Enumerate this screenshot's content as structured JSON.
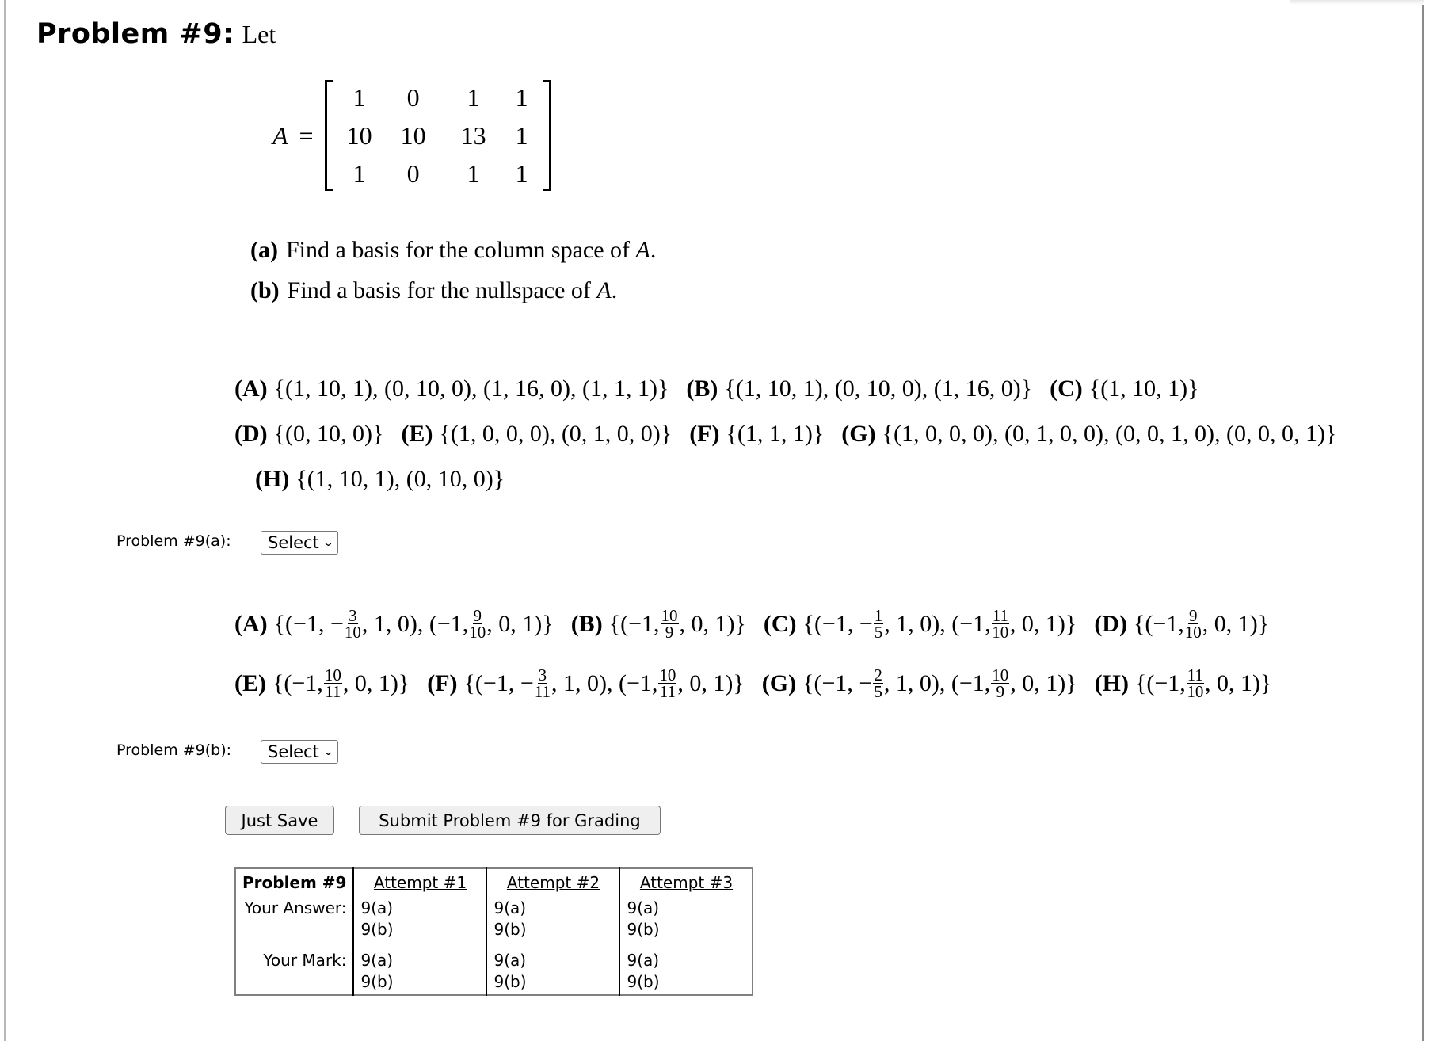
{
  "problem": {
    "title": "Problem #9:",
    "intro": "Let",
    "matrix_name": "A",
    "equals": "=",
    "matrix": [
      [
        "1",
        "0",
        "1",
        "1"
      ],
      [
        "10",
        "10",
        "13",
        "1"
      ],
      [
        "1",
        "0",
        "1",
        "1"
      ]
    ],
    "parts": [
      {
        "label": "(a)",
        "text": "Find a basis for the column space of ",
        "var": "A",
        "end": "."
      },
      {
        "label": "(b)",
        "text": "Find a basis for the nullspace of ",
        "var": "A",
        "end": "."
      }
    ]
  },
  "options_a": [
    {
      "label": "(A)",
      "text": "{(1, 10, 1), (0, 10, 0), (1, 16, 0), (1, 1, 1)}"
    },
    {
      "label": "(B)",
      "text": "{(1, 10, 1), (0, 10, 0), (1, 16, 0)}"
    },
    {
      "label": "(C)",
      "text": "{(1, 10, 1)}"
    },
    {
      "label": "(D)",
      "text": "{(0, 10, 0)}"
    },
    {
      "label": "(E)",
      "text": "{(1, 0, 0, 0), (0, 1, 0, 0)}"
    },
    {
      "label": "(F)",
      "text": "{(1, 1, 1)}"
    },
    {
      "label": "(G)",
      "text": "{(1, 0, 0, 0), (0, 1, 0, 0), (0, 0, 1, 0), (0, 0, 0, 1)}"
    },
    {
      "label": "(H)",
      "text": "{(1, 10, 1), (0, 10, 0)}"
    }
  ],
  "options_b": [
    {
      "label": "(A)",
      "pre1": "{(−1, −",
      "f1": [
        "3",
        "10"
      ],
      "mid": ", 1, 0), (−1, ",
      "f2": [
        "9",
        "10"
      ],
      "post": ", 0, 1)}"
    },
    {
      "label": "(B)",
      "pre1": "{(−1, ",
      "f1": [
        "10",
        "9"
      ],
      "mid": "",
      "f2": null,
      "post": ", 0, 1)}"
    },
    {
      "label": "(C)",
      "pre1": "{(−1, −",
      "f1": [
        "1",
        "5"
      ],
      "mid": ", 1, 0), (−1, ",
      "f2": [
        "11",
        "10"
      ],
      "post": ", 0, 1)}"
    },
    {
      "label": "(D)",
      "pre1": "{(−1, ",
      "f1": [
        "9",
        "10"
      ],
      "mid": "",
      "f2": null,
      "post": ", 0, 1)}"
    },
    {
      "label": "(E)",
      "pre1": "{(−1, ",
      "f1": [
        "10",
        "11"
      ],
      "mid": "",
      "f2": null,
      "post": ", 0, 1)}"
    },
    {
      "label": "(F)",
      "pre1": "{(−1, −",
      "f1": [
        "3",
        "11"
      ],
      "mid": ", 1, 0), (−1, ",
      "f2": [
        "10",
        "11"
      ],
      "post": ", 0, 1)}"
    },
    {
      "label": "(G)",
      "pre1": "{(−1, −",
      "f1": [
        "2",
        "5"
      ],
      "mid": ", 1, 0), (−1, ",
      "f2": [
        "10",
        "9"
      ],
      "post": ", 0, 1)}"
    },
    {
      "label": "(H)",
      "pre1": "{(−1, ",
      "f1": [
        "11",
        "10"
      ],
      "mid": "",
      "f2": null,
      "post": ", 0, 1)}"
    }
  ],
  "answer_a": {
    "label": "Problem #9(a):",
    "select_value": "Select"
  },
  "answer_b": {
    "label": "Problem #9(b):",
    "select_value": "Select"
  },
  "buttons": {
    "save": "Just Save",
    "submit": "Submit Problem #9 for Grading"
  },
  "attempts_table": {
    "header": "Problem #9",
    "attempts": [
      "Attempt #1",
      "Attempt #2",
      "Attempt #3"
    ],
    "answer_label": "Your Answer:",
    "mark_label": "Your Mark:",
    "cells": [
      "9(a)",
      "9(b)"
    ]
  }
}
